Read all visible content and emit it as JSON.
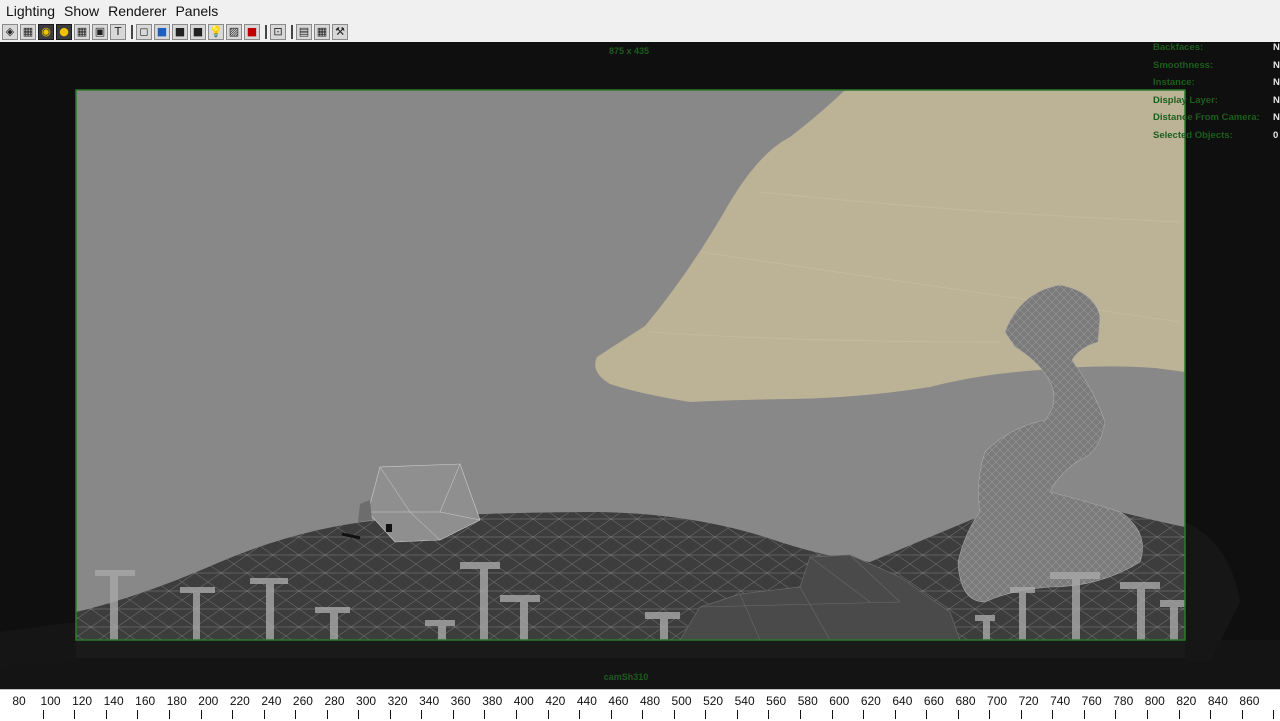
{
  "menu": [
    "Lighting",
    "Show",
    "Renderer",
    "Panels"
  ],
  "toolbar": {
    "groups": [
      [
        {
          "name": "select-camera-icon",
          "glyph": "◈"
        },
        {
          "name": "camera-attributes-icon",
          "glyph": "▦"
        },
        {
          "name": "bookmarks-icon",
          "glyph": "◉",
          "on": true
        },
        {
          "name": "image-plane-icon",
          "glyph": "●",
          "on": true
        },
        {
          "name": "grid-icon",
          "glyph": "▦"
        },
        {
          "name": "film-gate-icon",
          "glyph": "▣"
        },
        {
          "name": "safe-title-icon",
          "glyph": "T"
        }
      ],
      [
        {
          "name": "wireframe-icon",
          "glyph": "◻"
        },
        {
          "name": "smooth-shade-icon",
          "glyph": "■",
          "blue": true
        },
        {
          "name": "wireframe-on-shaded-icon",
          "glyph": "■"
        },
        {
          "name": "textured-icon",
          "glyph": "■"
        },
        {
          "name": "lights-icon",
          "glyph": "💡"
        },
        {
          "name": "shadows-icon",
          "glyph": "▨"
        },
        {
          "name": "high-quality-icon",
          "glyph": "■",
          "red": true
        }
      ],
      [
        {
          "name": "isolate-select-icon",
          "glyph": "⊡"
        }
      ],
      [
        {
          "name": "xray-icon",
          "glyph": "▤"
        },
        {
          "name": "xray-joints-icon",
          "glyph": "▦"
        },
        {
          "name": "xray-components-icon",
          "glyph": "⚒"
        }
      ]
    ]
  },
  "viewport": {
    "resolution": "875 x 435",
    "camera": "camSh310"
  },
  "hud": [
    {
      "label": "Backfaces:",
      "value": "N/"
    },
    {
      "label": "Smoothness:",
      "value": "N/"
    },
    {
      "label": "Instance:",
      "value": "N/"
    },
    {
      "label": "Display Layer:",
      "value": "N/"
    },
    {
      "label": "Distance From Camera:",
      "value": "N/"
    },
    {
      "label": "Selected Objects:",
      "value": "0"
    }
  ],
  "timeline": {
    "labels": [
      "80",
      "100",
      "120",
      "140",
      "160",
      "180",
      "200",
      "220",
      "240",
      "260",
      "280",
      "300",
      "320",
      "340",
      "360",
      "380",
      "400",
      "420",
      "440",
      "460",
      "480",
      "500",
      "520",
      "540",
      "560",
      "580",
      "600",
      "620",
      "640",
      "660",
      "680",
      "700",
      "720",
      "740",
      "760",
      "780",
      "800",
      "820",
      "840",
      "860"
    ]
  },
  "colors": {
    "viewport_background": "#0f0f0f",
    "film_gate_border": "#2b7a2b",
    "sky": "#888888",
    "sand": "#bcb296",
    "hud_green": "#1c5e1c"
  }
}
